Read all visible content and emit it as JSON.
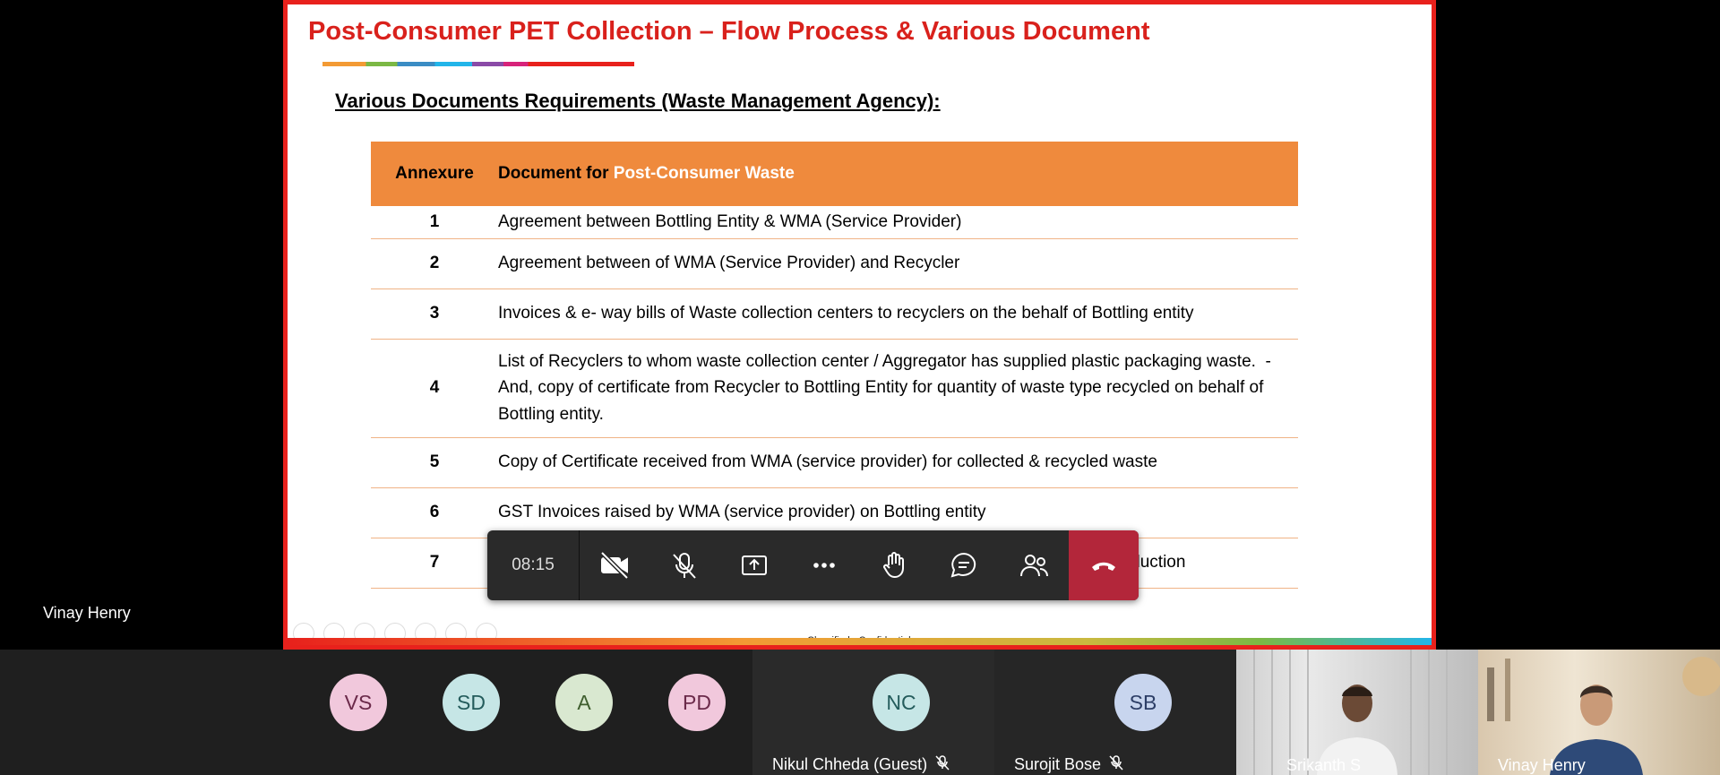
{
  "presenter": {
    "name": "Vinay Henry"
  },
  "slide": {
    "title": "Post-Consumer PET Collection – Flow Process & Various Document",
    "subtitle": "Various Documents Requirements (Waste Management Agency):",
    "table": {
      "header_col1": "Annexure",
      "header_col2_prefix": "Document for ",
      "header_col2_highlight": "Post-Consumer Waste",
      "rows": [
        {
          "num": "1",
          "text": "Agreement between Bottling Entity & WMA (Service Provider)"
        },
        {
          "num": "2",
          "text": "Agreement between of WMA (Service Provider) and Recycler"
        },
        {
          "num": "3",
          "text": "Invoices & e- way bills of Waste collection centers to recyclers on the behalf of Bottling entity"
        },
        {
          "num": "4",
          "text": "List of Recyclers to whom waste collection center / Aggregator has supplied plastic packaging waste.  - And, copy of certificate from Recycler to Bottling Entity for quantity of waste type recycled on behalf of Bottling entity."
        },
        {
          "num": "5",
          "text": "Copy of Certificate received from WMA (service provider) for collected & recycled waste"
        },
        {
          "num": "6",
          "text": "GST Invoices raised by WMA (service provider) on Bottling entity"
        },
        {
          "num": "7",
          "text": "Scanned copy of certificate for Quantity purchased PET Packaging materials for Production"
        }
      ]
    },
    "footer": "Classified - Confidential"
  },
  "controls": {
    "timer": "08:15"
  },
  "participants": [
    {
      "initials": "VS",
      "bg": "#f1c8dc",
      "fg": "#6b2a4a"
    },
    {
      "initials": "SD",
      "bg": "#c6e6e6",
      "fg": "#245c5c"
    },
    {
      "initials": "A",
      "bg": "#d9e8d0",
      "fg": "#3f5e2e"
    },
    {
      "initials": "PD",
      "bg": "#f1c8dc",
      "fg": "#6b2a4a"
    }
  ],
  "named_participants": [
    {
      "initials": "NC",
      "name": "Nikul Chheda (Guest)",
      "bg": "#c6e6e6",
      "fg": "#245c5c"
    },
    {
      "initials": "SB",
      "name": "Surojit Bose",
      "bg": "#c8d5ee",
      "fg": "#2d3e66"
    }
  ],
  "video_participants": [
    {
      "name": "Srikanth S"
    },
    {
      "name": "Vinay Henry"
    }
  ],
  "colors": {
    "accent_red": "#e8211c",
    "table_header": "#ef8a3d",
    "hangup": "#b3263a"
  }
}
